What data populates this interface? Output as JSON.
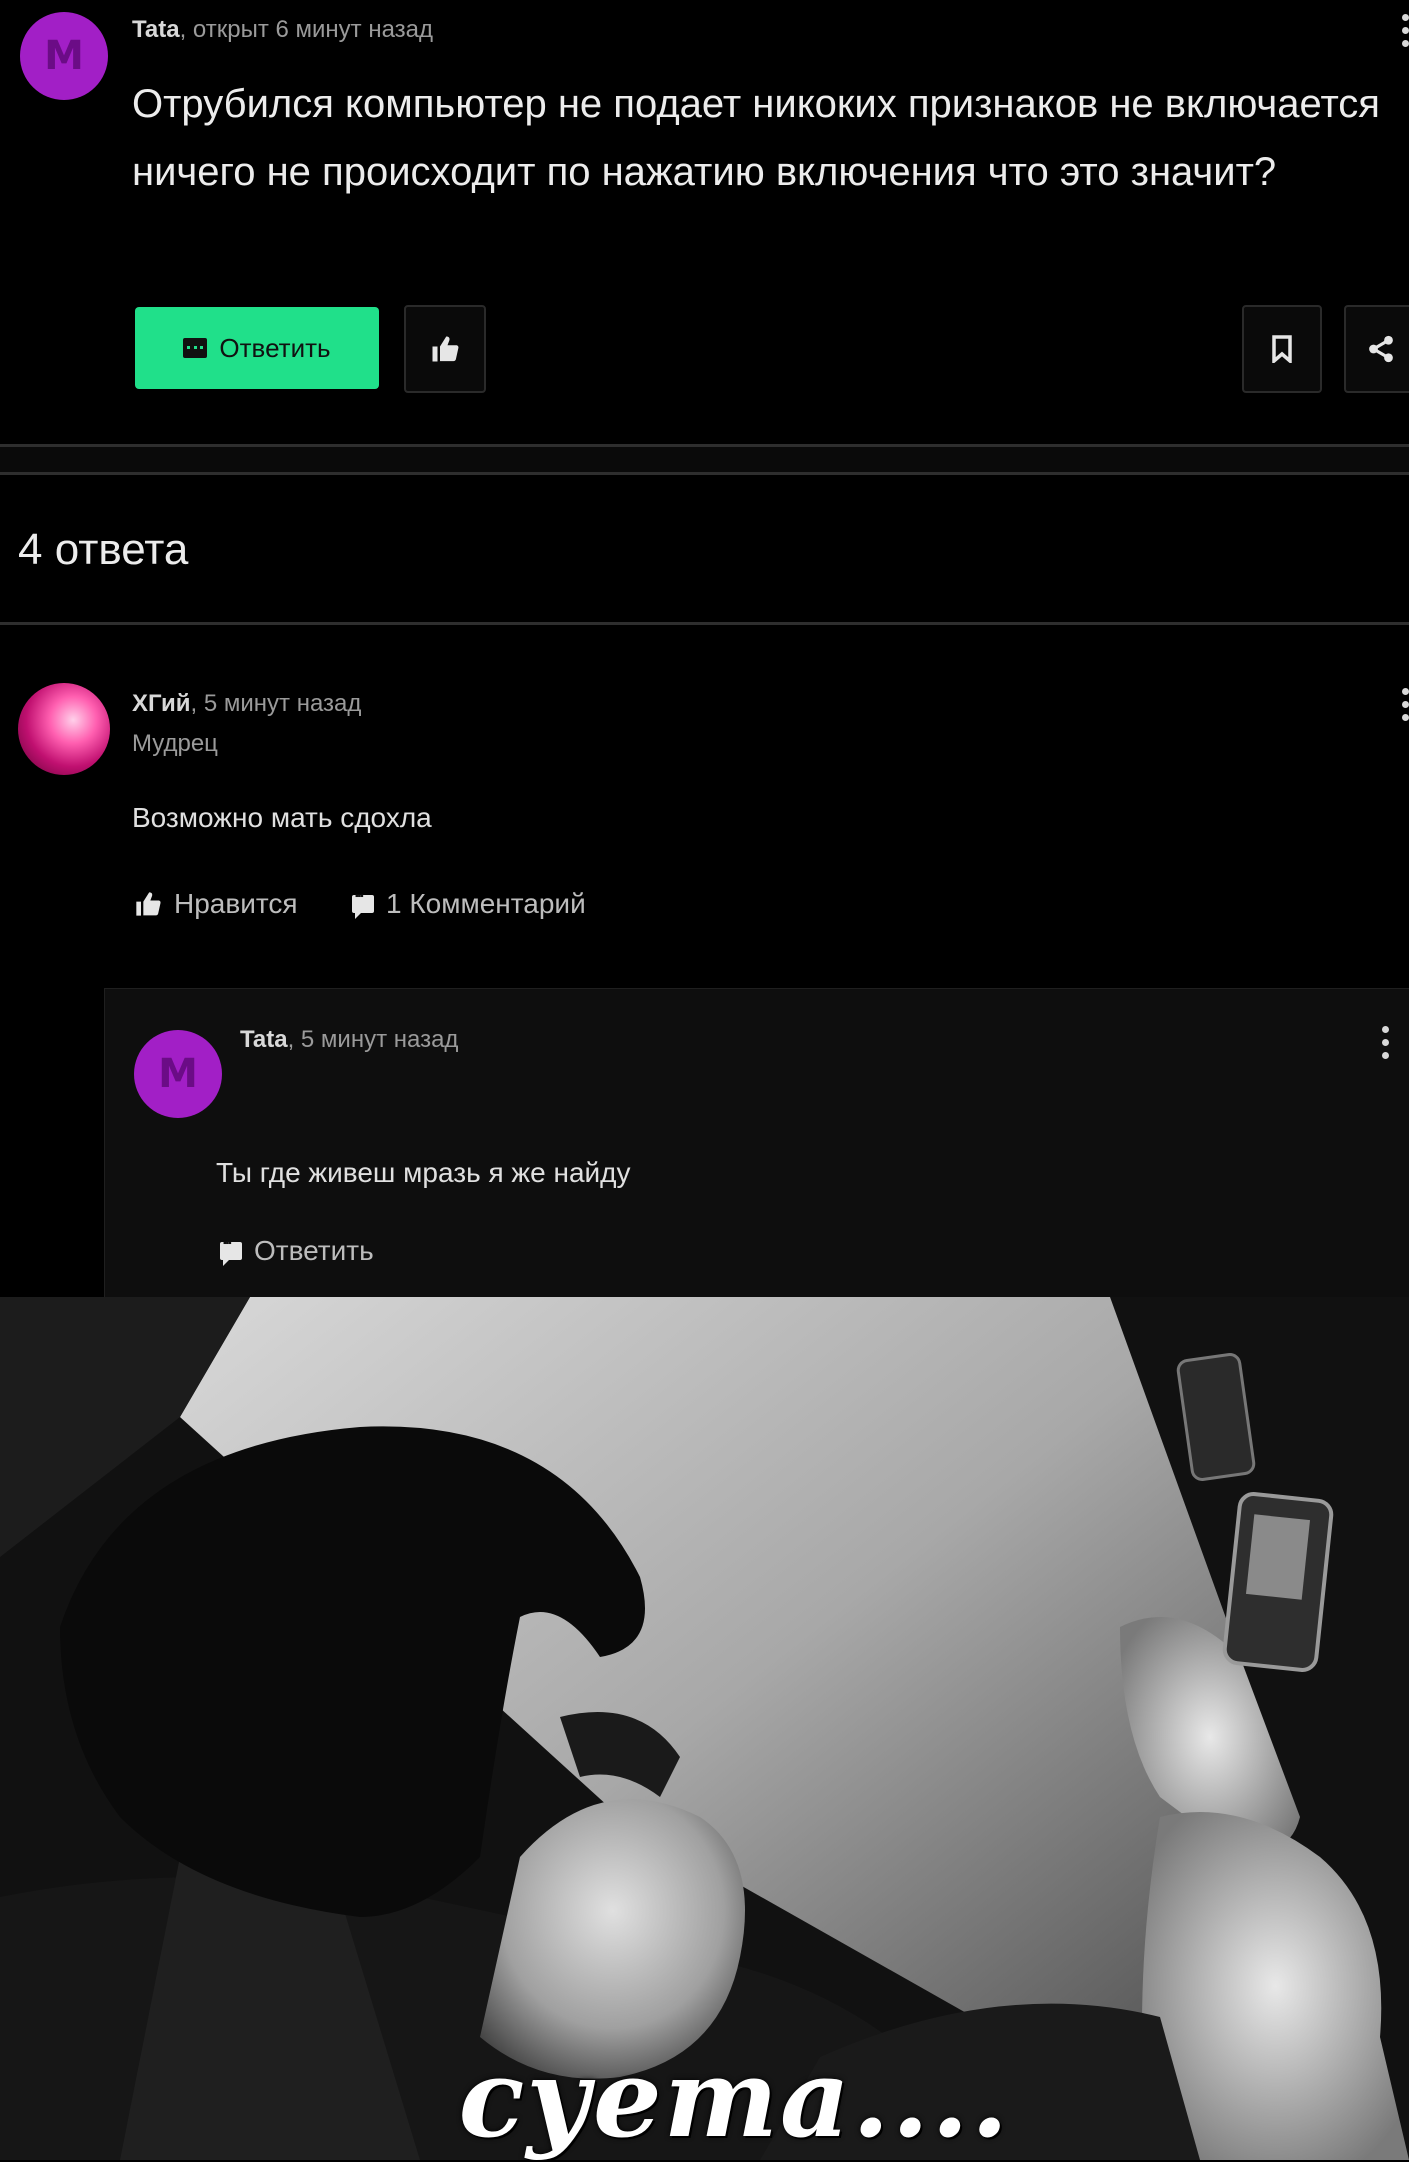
{
  "question": {
    "avatar_letter": "M",
    "author": "Tata",
    "time": ", открыт 6 минут назад",
    "text": "Отрубился компьютер не подает никоких признаков не включается ничего не происходит по нажатию включения что это значит?",
    "reply_label": "Ответить",
    "icons": [
      "like-icon",
      "bookmark-icon",
      "share-icon"
    ]
  },
  "answers_header": "4 ответа",
  "answer": {
    "author": "ХГий",
    "time": ", 5 минут назад",
    "rank": "Мудрец",
    "text": "Возможно мать сдохла",
    "like_label": "Нравится",
    "comments_label": "1 Комментарий"
  },
  "comment": {
    "avatar_letter": "M",
    "author": "Tata",
    "time": ", 5 минут назад",
    "text": "Ты где живеш мразь я же найду",
    "reply_label": "Ответить"
  },
  "meme_caption": "суета....",
  "colors": {
    "accent_green": "#20e08a",
    "avatar_purple": "#a21fc6",
    "background": "#000000"
  }
}
